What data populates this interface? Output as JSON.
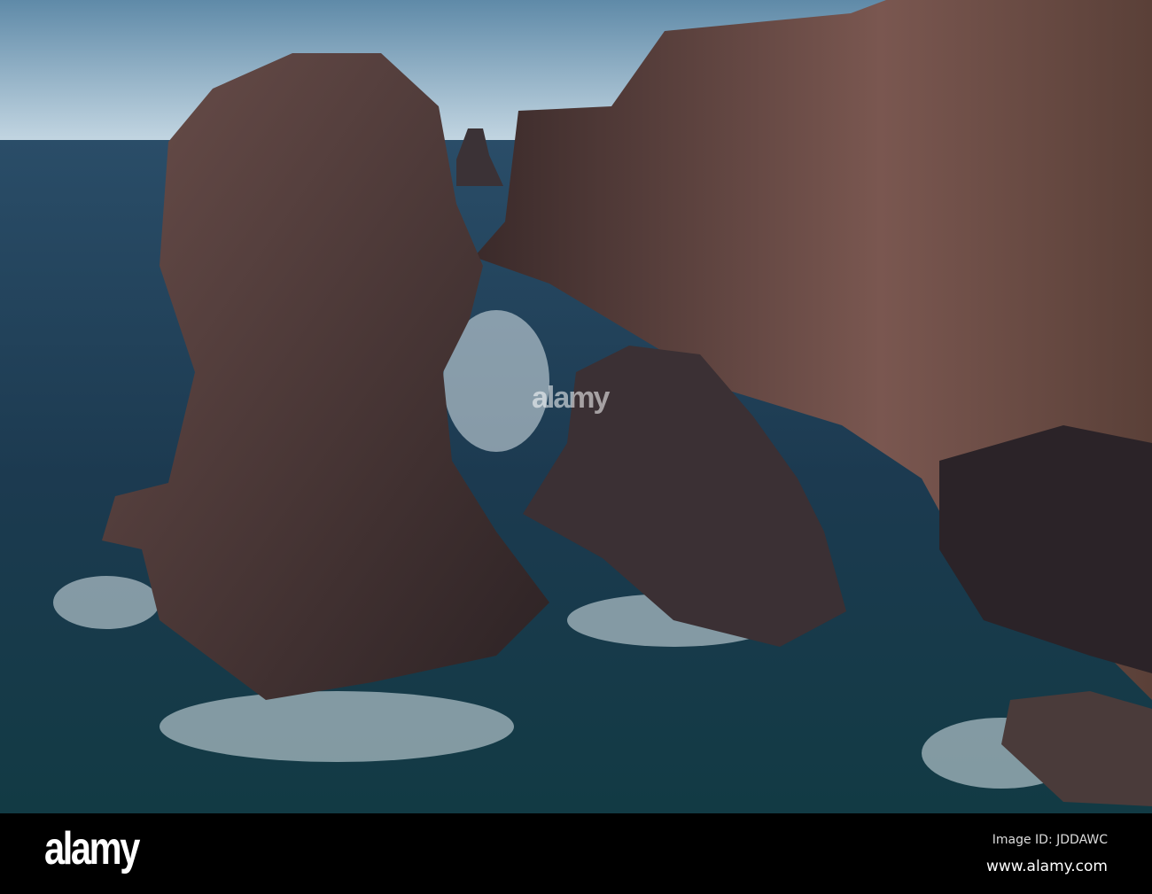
{
  "photo": {
    "subject": "Sea stacks and cliffs",
    "colors": {
      "sky": "#9fc0d6",
      "sea": "#1d3f55",
      "rock": "#4a3634",
      "foam": "#dfe9ee"
    }
  },
  "watermark": {
    "logo": "alamy"
  },
  "footer": {
    "logo": "alamy",
    "image_id": "Image ID: JDDAWC",
    "website": "www.alamy.com"
  }
}
